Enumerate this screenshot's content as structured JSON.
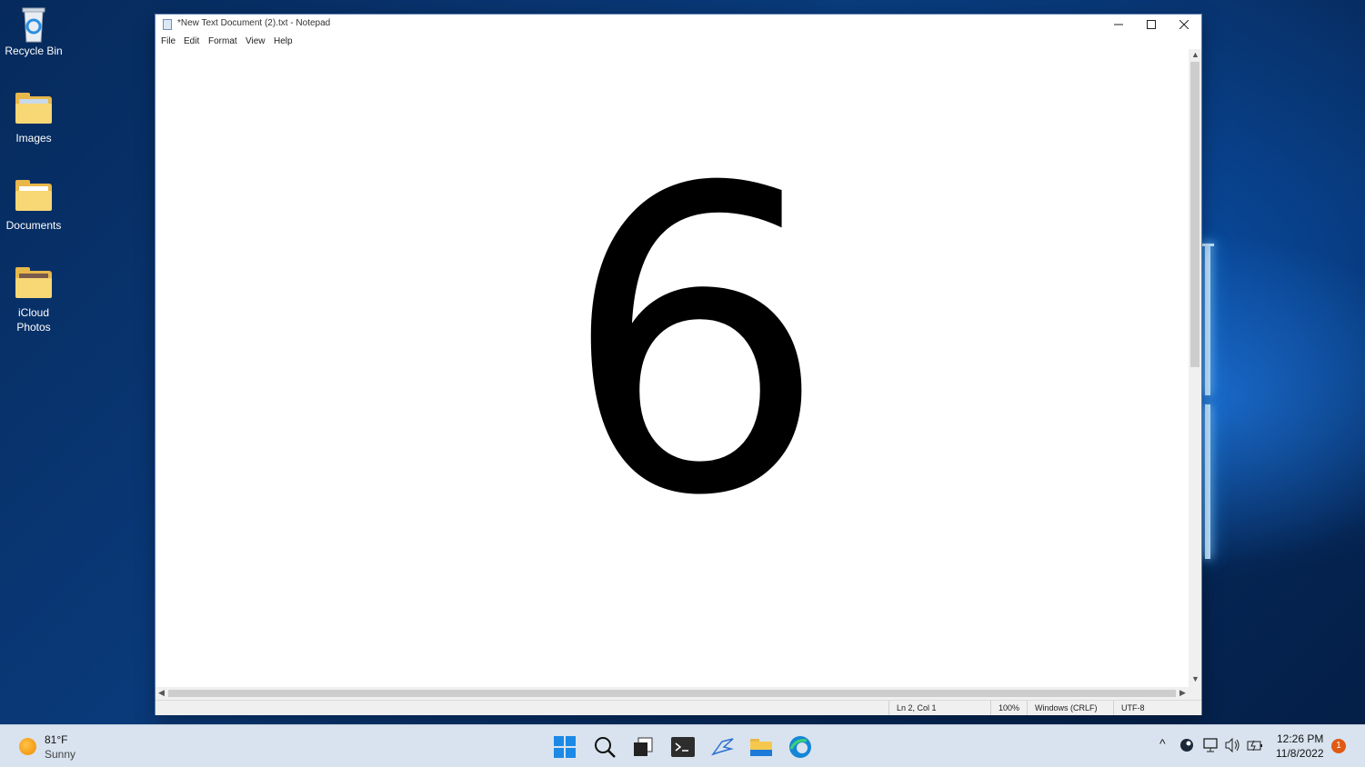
{
  "desktop": {
    "icons": [
      {
        "label": "Recycle Bin",
        "icon": "recycle-bin-icon"
      },
      {
        "label": "Images",
        "icon": "folder-icon"
      },
      {
        "label": "Documents",
        "icon": "folder-icon"
      },
      {
        "label": "iCloud Photos",
        "icon": "folder-icon"
      }
    ]
  },
  "notepad": {
    "title": "*New Text Document (2).txt - Notepad",
    "menu": [
      "File",
      "Edit",
      "Format",
      "View",
      "Help"
    ],
    "content": "6",
    "status": {
      "position": "Ln 2, Col 1",
      "zoom": "100%",
      "line_ending": "Windows (CRLF)",
      "encoding": "UTF-8"
    }
  },
  "taskbar": {
    "weather": {
      "temp": "81°F",
      "condition": "Sunny"
    },
    "apps": [
      "start-icon",
      "search-icon",
      "task-view-icon",
      "terminal-icon",
      "app-icon",
      "file-explorer-icon",
      "edge-icon"
    ],
    "clock": {
      "time": "12:26 PM",
      "date": "11/8/2022"
    },
    "notification_count": "1"
  },
  "colors": {
    "accent": "#0067c0",
    "desktop": "#0a3a7a",
    "taskbar": "#d8e3ef"
  }
}
